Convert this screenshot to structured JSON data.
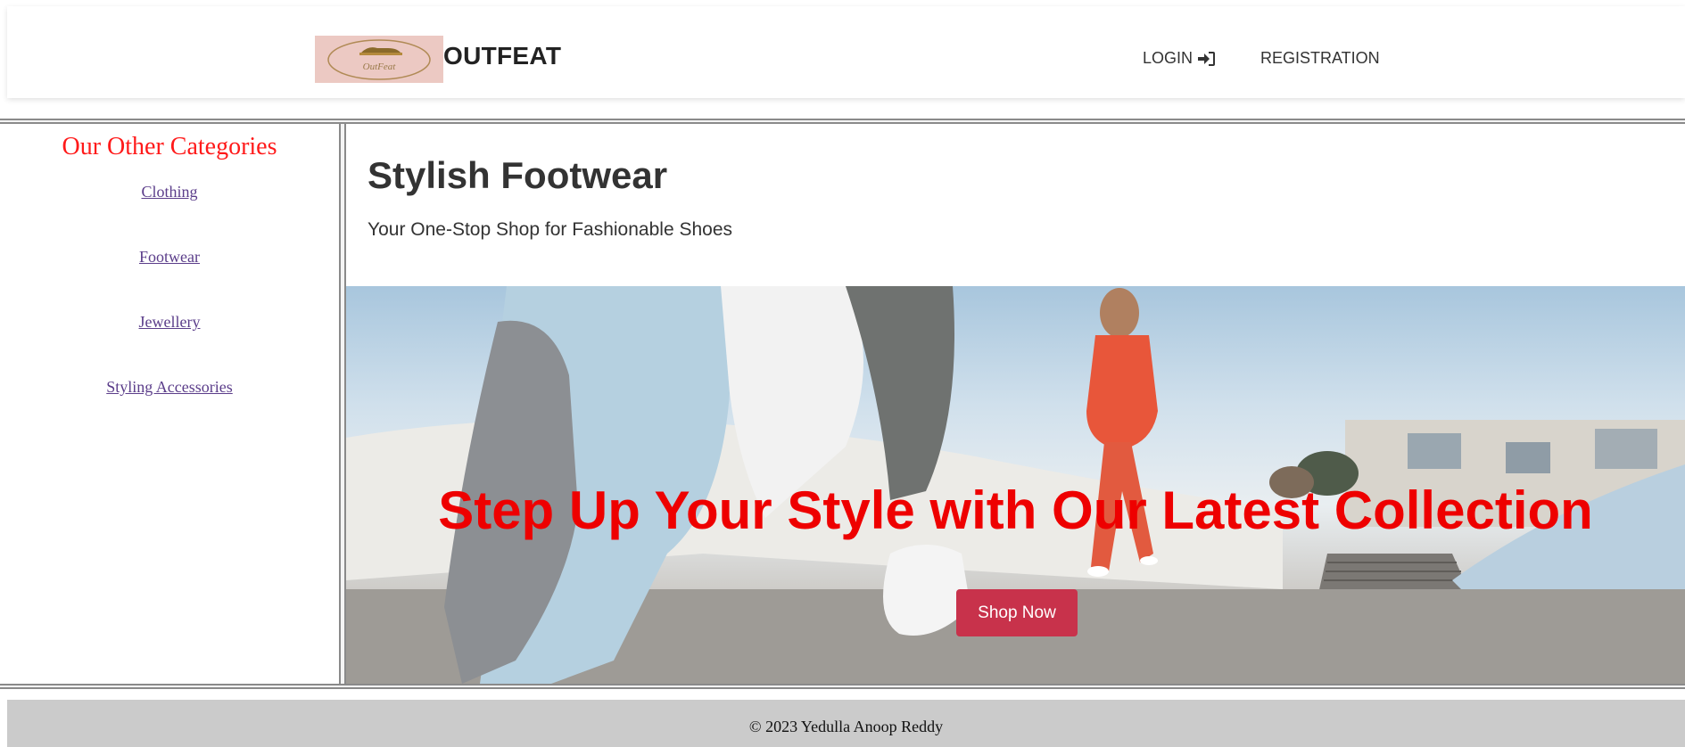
{
  "header": {
    "logo_text": "OutFeat",
    "brand": "OUTFEAT",
    "nav": {
      "login_label": "LOGIN",
      "login_icon": "sign-in-icon",
      "registration_label": "REGISTRATION"
    }
  },
  "sidebar": {
    "title": "Our Other Categories",
    "title_color": "#ff1a1a",
    "items": [
      {
        "label": "Clothing"
      },
      {
        "label": "Footwear"
      },
      {
        "label": "Jewellery"
      },
      {
        "label": "Styling Accessories"
      }
    ]
  },
  "main": {
    "title": "Stylish Footwear",
    "subtitle": "Your One-Stop Shop for Fashionable Shoes",
    "hero": {
      "heading": "Step Up Your Style with Our Latest Collection",
      "heading_color": "#ee0000",
      "button_label": "Shop Now",
      "button_color": "#c8324b"
    }
  },
  "footer": {
    "text": "© 2023 Yedulla Anoop Reddy"
  }
}
